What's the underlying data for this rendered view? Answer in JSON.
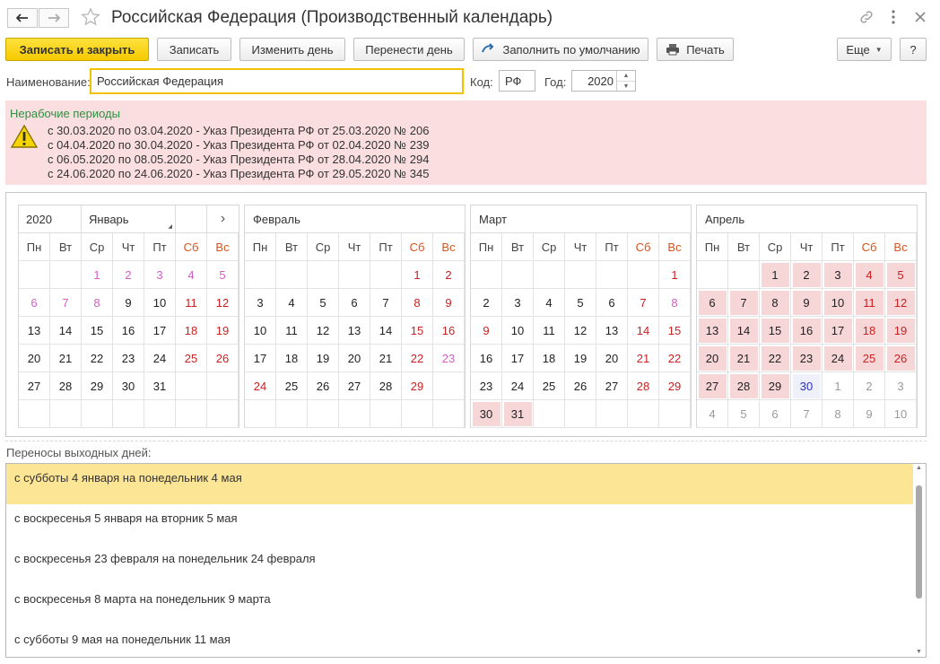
{
  "window": {
    "title": "Российская Федерация (Производственный календарь)"
  },
  "toolbar": {
    "save_close": "Записать и закрыть",
    "save": "Записать",
    "change_day": "Изменить день",
    "move_day": "Перенести день",
    "fill_default": "Заполнить по умолчанию",
    "print": "Печать",
    "more": "Еще",
    "help": "?"
  },
  "form": {
    "name_label": "Наименование:",
    "name_value": "Российская Федерация",
    "code_label": "Код:",
    "code_value": "РФ",
    "year_label": "Год:",
    "year_value": "2020"
  },
  "warning": {
    "title": "Нерабочие периоды",
    "lines": [
      "с 30.03.2020 по 03.04.2020 - Указ Президента РФ от 25.03.2020 № 206",
      "с 04.04.2020 по 30.04.2020 - Указ Президента РФ от 02.04.2020 № 239",
      "с 06.05.2020 по 08.05.2020 - Указ Президента РФ от 28.04.2020 № 294",
      "с 24.06.2020 по 24.06.2020 - Указ Президента РФ от 29.05.2020 № 345"
    ]
  },
  "calendar": {
    "year": "2020",
    "next_symbol": "›",
    "weekdays": [
      "Пн",
      "Вт",
      "Ср",
      "Чт",
      "Пт",
      "Сб",
      "Вс"
    ],
    "months": [
      {
        "name": "Январь",
        "cells": [
          [
            "",
            ""
          ],
          [
            "",
            ""
          ],
          [
            "1",
            "pink"
          ],
          [
            "2",
            "pink"
          ],
          [
            "3",
            "pink"
          ],
          [
            "4",
            "pink"
          ],
          [
            "5",
            "pink"
          ],
          [
            "6",
            "pink"
          ],
          [
            "7",
            "pink"
          ],
          [
            "8",
            "pink"
          ],
          [
            "9",
            ""
          ],
          [
            "10",
            ""
          ],
          [
            "11",
            "red"
          ],
          [
            "12",
            "red"
          ],
          [
            "13",
            ""
          ],
          [
            "14",
            ""
          ],
          [
            "15",
            ""
          ],
          [
            "16",
            ""
          ],
          [
            "17",
            ""
          ],
          [
            "18",
            "red"
          ],
          [
            "19",
            "red"
          ],
          [
            "20",
            ""
          ],
          [
            "21",
            ""
          ],
          [
            "22",
            ""
          ],
          [
            "23",
            ""
          ],
          [
            "24",
            ""
          ],
          [
            "25",
            "red"
          ],
          [
            "26",
            "red"
          ],
          [
            "27",
            ""
          ],
          [
            "28",
            ""
          ],
          [
            "29",
            ""
          ],
          [
            "30",
            ""
          ],
          [
            "31",
            ""
          ],
          [
            "",
            ""
          ],
          [
            "",
            ""
          ],
          [
            "",
            ""
          ],
          [
            "",
            ""
          ],
          [
            "",
            ""
          ],
          [
            "",
            ""
          ],
          [
            "",
            ""
          ],
          [
            "",
            ""
          ],
          [
            "",
            ""
          ]
        ]
      },
      {
        "name": "Февраль",
        "cells": [
          [
            "",
            ""
          ],
          [
            "",
            ""
          ],
          [
            "",
            ""
          ],
          [
            "",
            ""
          ],
          [
            "",
            ""
          ],
          [
            "1",
            "red"
          ],
          [
            "2",
            "red"
          ],
          [
            "3",
            ""
          ],
          [
            "4",
            ""
          ],
          [
            "5",
            ""
          ],
          [
            "6",
            ""
          ],
          [
            "7",
            ""
          ],
          [
            "8",
            "red"
          ],
          [
            "9",
            "red"
          ],
          [
            "10",
            ""
          ],
          [
            "11",
            ""
          ],
          [
            "12",
            ""
          ],
          [
            "13",
            ""
          ],
          [
            "14",
            ""
          ],
          [
            "15",
            "red"
          ],
          [
            "16",
            "red"
          ],
          [
            "17",
            ""
          ],
          [
            "18",
            ""
          ],
          [
            "19",
            ""
          ],
          [
            "20",
            ""
          ],
          [
            "21",
            ""
          ],
          [
            "22",
            "red"
          ],
          [
            "23",
            "pink"
          ],
          [
            "24",
            "red"
          ],
          [
            "25",
            ""
          ],
          [
            "26",
            ""
          ],
          [
            "27",
            ""
          ],
          [
            "28",
            ""
          ],
          [
            "29",
            "red"
          ],
          [
            "",
            ""
          ],
          [
            "",
            ""
          ],
          [
            "",
            ""
          ],
          [
            "",
            ""
          ],
          [
            "",
            ""
          ],
          [
            "",
            ""
          ],
          [
            "",
            ""
          ],
          [
            "",
            ""
          ]
        ]
      },
      {
        "name": "Март",
        "cells": [
          [
            "",
            ""
          ],
          [
            "",
            ""
          ],
          [
            "",
            ""
          ],
          [
            "",
            ""
          ],
          [
            "",
            ""
          ],
          [
            "",
            ""
          ],
          [
            "1",
            "red"
          ],
          [
            "2",
            ""
          ],
          [
            "3",
            ""
          ],
          [
            "4",
            ""
          ],
          [
            "5",
            ""
          ],
          [
            "6",
            ""
          ],
          [
            "7",
            "red"
          ],
          [
            "8",
            "pink"
          ],
          [
            "9",
            "red"
          ],
          [
            "10",
            ""
          ],
          [
            "11",
            ""
          ],
          [
            "12",
            ""
          ],
          [
            "13",
            ""
          ],
          [
            "14",
            "red"
          ],
          [
            "15",
            "red"
          ],
          [
            "16",
            ""
          ],
          [
            "17",
            ""
          ],
          [
            "18",
            ""
          ],
          [
            "19",
            ""
          ],
          [
            "20",
            ""
          ],
          [
            "21",
            "red"
          ],
          [
            "22",
            "red"
          ],
          [
            "23",
            ""
          ],
          [
            "24",
            ""
          ],
          [
            "25",
            ""
          ],
          [
            "26",
            ""
          ],
          [
            "27",
            ""
          ],
          [
            "28",
            "red"
          ],
          [
            "29",
            "red"
          ],
          [
            "30",
            "hl"
          ],
          [
            "31",
            "hl"
          ],
          [
            "",
            ""
          ],
          [
            "",
            ""
          ],
          [
            "",
            ""
          ],
          [
            "",
            ""
          ],
          [
            "",
            ""
          ]
        ]
      },
      {
        "name": "Апрель",
        "cells": [
          [
            "",
            ""
          ],
          [
            "",
            ""
          ],
          [
            "1",
            "hl"
          ],
          [
            "2",
            "hl"
          ],
          [
            "3",
            "hl"
          ],
          [
            "4",
            "hl red"
          ],
          [
            "5",
            "hl red"
          ],
          [
            "6",
            "hl"
          ],
          [
            "7",
            "hl"
          ],
          [
            "8",
            "hl"
          ],
          [
            "9",
            "hl"
          ],
          [
            "10",
            "hl"
          ],
          [
            "11",
            "hl red"
          ],
          [
            "12",
            "hl red"
          ],
          [
            "13",
            "hl"
          ],
          [
            "14",
            "hl"
          ],
          [
            "15",
            "hl"
          ],
          [
            "16",
            "hl"
          ],
          [
            "17",
            "hl"
          ],
          [
            "18",
            "hl red"
          ],
          [
            "19",
            "hl red"
          ],
          [
            "20",
            "hl"
          ],
          [
            "21",
            "hl"
          ],
          [
            "22",
            "hl"
          ],
          [
            "23",
            "hl"
          ],
          [
            "24",
            "hl"
          ],
          [
            "25",
            "hl red"
          ],
          [
            "26",
            "hl red"
          ],
          [
            "27",
            "hl"
          ],
          [
            "28",
            "hl"
          ],
          [
            "29",
            "hl"
          ],
          [
            "30",
            "hl hlw blue"
          ],
          [
            "1",
            "grey"
          ],
          [
            "2",
            "grey"
          ],
          [
            "3",
            "grey"
          ],
          [
            "4",
            "grey"
          ],
          [
            "5",
            "grey"
          ],
          [
            "6",
            "grey"
          ],
          [
            "7",
            "grey"
          ],
          [
            "8",
            "grey"
          ],
          [
            "9",
            "grey"
          ],
          [
            "10",
            "grey"
          ]
        ]
      }
    ]
  },
  "transfers": {
    "label": "Переносы выходных дней:",
    "items": [
      "с субботы 4 января на понедельник 4 мая",
      "с воскресенья 5 января на вторник 5 мая",
      "с воскресенья 23 февраля на понедельник 24 февраля",
      "с воскресенья 8 марта на понедельник 9 марта",
      "с субботы 9 мая на понедельник 11 мая"
    ]
  },
  "colors": {
    "accent_yellow": "#f5c900",
    "warning_bg": "#fbdfe0",
    "warning_title": "#2b8f3f",
    "holiday_red": "#cc1f1f",
    "selected_row": "#fde596"
  }
}
